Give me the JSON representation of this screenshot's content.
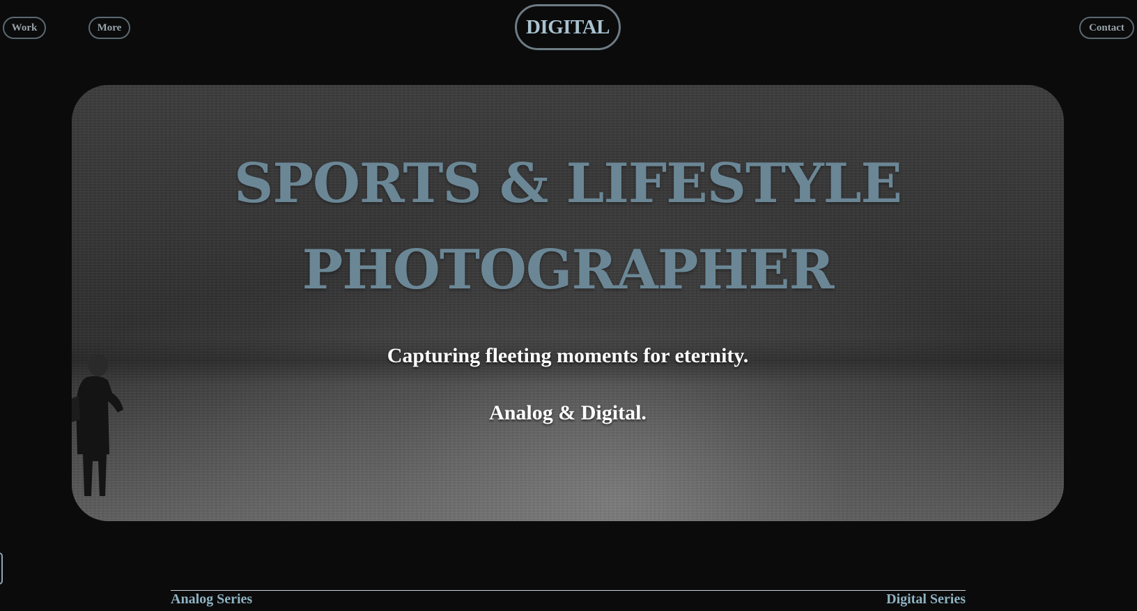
{
  "nav": {
    "work_label": "Work",
    "more_label": "More",
    "contact_label": "Contact",
    "logo_label": "DIGITAL"
  },
  "hero": {
    "title_line_1": "SPORTS & LIFESTYLE",
    "title_line_2": "PHOTOGRAPHER",
    "subtitle_1": "Capturing fleeting moments for eternity.",
    "subtitle_2": "Analog & Digital."
  },
  "series": {
    "analog_label": "Analog Series",
    "digital_label": "Digital Series"
  },
  "colors": {
    "background": "#0b0b0c",
    "title": "#6b8796",
    "series_link": "#8fb3c2",
    "logo_text": "#a9c3cf"
  }
}
